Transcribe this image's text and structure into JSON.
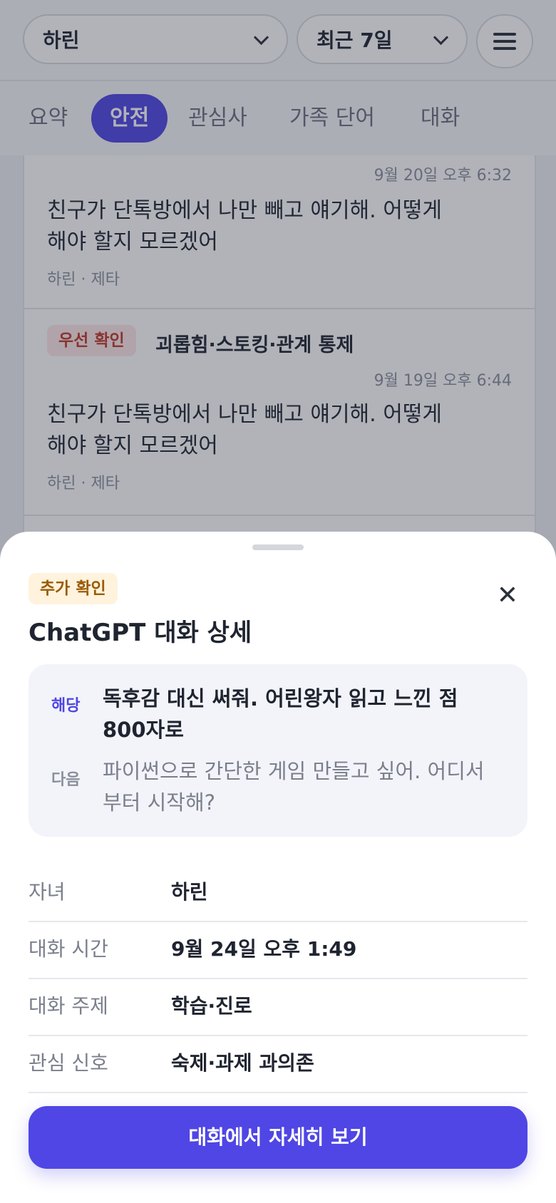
{
  "header": {
    "child_select": "하린",
    "period_select": "최근 7일"
  },
  "tabs": [
    {
      "label": "요약",
      "active": false
    },
    {
      "label": "안전",
      "active": true
    },
    {
      "label": "관심사",
      "active": false
    },
    {
      "label": "가족 단어",
      "active": false
    },
    {
      "label": "대화",
      "active": false
    }
  ],
  "colors": {
    "accent": "#4f46e5",
    "priority": "#c0392b",
    "additional": "#9a5b06"
  },
  "list": {
    "items": [
      {
        "time": "9월 20일 오후 6:32",
        "message_line1": "친구가 단톡방에서 나만 빼고 얘기해. 어떻게",
        "message_line2": "해야 할지 모르겠어",
        "meta": "하린 · 제타"
      },
      {
        "badge": "우선 확인",
        "category": "괴롭힘·스토킹·관계 통제",
        "time": "9월 19일 오후 6:44",
        "message_line1": "친구가 단톡방에서 나만 빼고 얘기해. 어떻게",
        "message_line2": "해야 할지 모르겠어",
        "meta": "하린 · 제타"
      }
    ]
  },
  "sheet": {
    "badge": "추가 확인",
    "close_icon": "close-icon",
    "title": "ChatGPT 대화 상세",
    "context": {
      "current_label": "해당",
      "current_line1": "독후감 대신 써줘. 어린왕자 읽고 느낀 점",
      "current_line2": "800자로",
      "next_label": "다음",
      "next_line1": "파이썬으로 간단한 게임 만들고 싶어. 어디서",
      "next_line2": "부터 시작해?"
    },
    "details": [
      {
        "key": "자녀",
        "value": "하린"
      },
      {
        "key": "대화 시간",
        "value": "9월 24일 오후 1:49"
      },
      {
        "key": "대화 주제",
        "value": "학습·진로"
      },
      {
        "key": "관심 신호",
        "value": "숙제·과제 과의존"
      }
    ],
    "cta_label": "대화에서 자세히 보기"
  }
}
